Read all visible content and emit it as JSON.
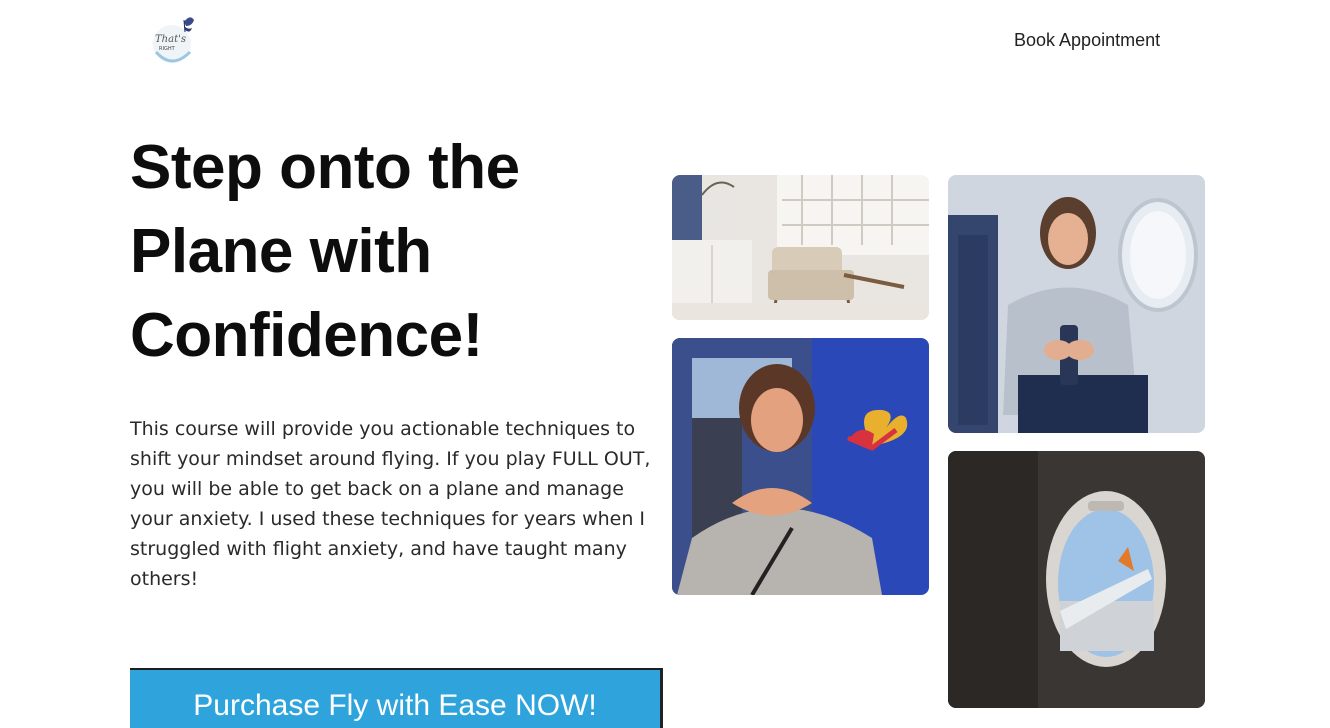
{
  "header": {
    "nav_link": "Book Appointment",
    "logo_icon": "butterfly-logo-icon"
  },
  "hero": {
    "headline": "Step onto the Plane with Confidence!",
    "body": "This course will provide you actionable techniques to shift your mindset around flying. If you play FULL OUT, you will be able to get back on a plane and manage your anxiety. I used these techniques for years when I struggled with flight anxiety, and have taught many others!",
    "cta_label": "Purchase Fly with Ease NOW!"
  },
  "colors": {
    "cta_background": "#2fa4dc",
    "headline": "#0d0d0d",
    "body_text": "#2a2a2a"
  }
}
